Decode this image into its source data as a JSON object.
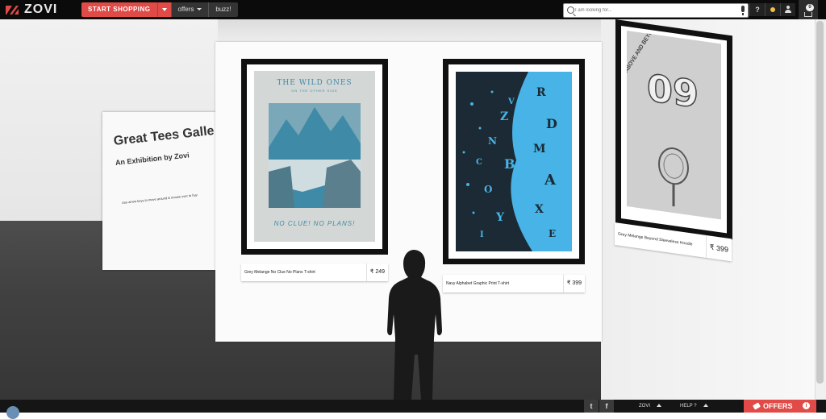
{
  "brand": {
    "name": "ZOVI"
  },
  "nav": {
    "start_shopping": "START SHOPPING",
    "offers": "offers",
    "buzz": "buzz!"
  },
  "search": {
    "placeholder": "I am looking for..."
  },
  "toolbar": {
    "help": "?"
  },
  "cart": {
    "count": "0"
  },
  "gallery": {
    "title": "Great Tees Galle",
    "subtitle": "An Exhibition by Zovi",
    "hint": "Use arrow keys to move around & mouse over to buy"
  },
  "products": [
    {
      "name": "Grey Melange No Clue No Plans T-shirt",
      "price": "₹ 249",
      "art_title": "THE WILD ONES",
      "art_sub": "ON THE OTHER SIDE",
      "art_caption": "NO CLUE! NO PLANS!"
    },
    {
      "name": "Navy Alphabet Graphic Print T-shirt",
      "price": "₹ 399"
    },
    {
      "name": "Grey Melange Beyond Sleeveless Hoodie",
      "price": "₹ 399",
      "art_title": "ABOVE AND BEYOND",
      "art_number": "09"
    }
  ],
  "footer": {
    "twitter": "t",
    "facebook": "f",
    "zovi": "ZOVI",
    "help": "HELP ?",
    "offers": "OFFERS"
  },
  "colors": {
    "accent": "#e04b47",
    "topbar": "#0b0b0b",
    "art_teal": "#3f8aa6",
    "art_navy": "#1b2a34",
    "art_cyan": "#48b3e6"
  }
}
